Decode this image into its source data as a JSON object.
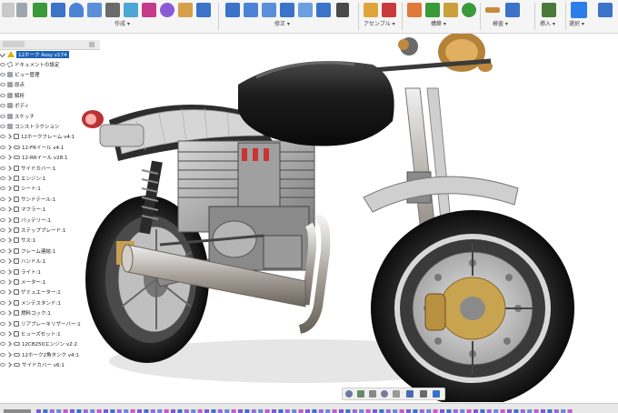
{
  "toolbar": {
    "groups": [
      {
        "name": "create",
        "label": "作成 ▾"
      },
      {
        "name": "modify",
        "label": "修正 ▾"
      },
      {
        "name": "assemble",
        "label": "アセンブル ▾"
      },
      {
        "name": "construct",
        "label": "構築 ▾"
      },
      {
        "name": "inspect",
        "label": "検査 ▾"
      },
      {
        "name": "insert",
        "label": "挿入 ▾"
      },
      {
        "name": "select",
        "label": "選択 ▾"
      }
    ]
  },
  "browser": {
    "doc_title": "12ホーク Assy v174",
    "items": [
      {
        "label": "ドキュメントの設定",
        "icon": "gear-icon",
        "indent": 1
      },
      {
        "label": "ビュー管理",
        "icon": "folder-icon",
        "indent": 1
      },
      {
        "label": "原点",
        "icon": "folder-icon",
        "indent": 1
      },
      {
        "label": "解析",
        "icon": "folder-icon",
        "indent": 1
      },
      {
        "label": "ボディ",
        "icon": "folder-icon",
        "indent": 1
      },
      {
        "label": "スケッチ",
        "icon": "folder-icon",
        "indent": 1
      },
      {
        "label": "コンストラクション",
        "icon": "folder-icon",
        "indent": 1
      },
      {
        "label": "12ホークフレーム v4:1",
        "icon": "component-icon",
        "indent": 2
      },
      {
        "label": "12-FRイール v4:1",
        "icon": "link-icon",
        "indent": 2
      },
      {
        "label": "12-RRイール v28:1",
        "icon": "link-icon",
        "indent": 2
      },
      {
        "label": "サイドカバー:1",
        "icon": "component-icon",
        "indent": 2
      },
      {
        "label": "エンジン:1",
        "icon": "component-icon",
        "indent": 2
      },
      {
        "label": "シート:1",
        "icon": "component-icon",
        "indent": 2
      },
      {
        "label": "サンドテール:1",
        "icon": "component-icon",
        "indent": 2
      },
      {
        "label": "マフラー:1",
        "icon": "component-icon",
        "indent": 2
      },
      {
        "label": "バッテリー:1",
        "icon": "component-icon",
        "indent": 2
      },
      {
        "label": "ステップブレード:1",
        "icon": "component-icon",
        "indent": 2
      },
      {
        "label": "サス:1",
        "icon": "component-icon",
        "indent": 2
      },
      {
        "label": "フレーム連結:1",
        "icon": "component-icon",
        "indent": 2
      },
      {
        "label": "ハンドル:1",
        "icon": "component-icon",
        "indent": 2
      },
      {
        "label": "ライト:1",
        "icon": "component-icon",
        "indent": 2
      },
      {
        "label": "メーター:1",
        "icon": "component-icon",
        "indent": 2
      },
      {
        "label": "ゲミュエーター:1",
        "icon": "component-icon",
        "indent": 2
      },
      {
        "label": "メンテスタンド:1",
        "icon": "component-icon",
        "indent": 2
      },
      {
        "label": "燃料コック:1",
        "icon": "component-icon",
        "indent": 2
      },
      {
        "label": "リアブレーキリザーバー:1",
        "icon": "component-icon",
        "indent": 2
      },
      {
        "label": "ヒューズセット:1",
        "icon": "component-icon",
        "indent": 2
      },
      {
        "label": "12CB250エンジン v2:2",
        "icon": "link-icon",
        "indent": 2
      },
      {
        "label": "12ホーク2角タンク v4:1",
        "icon": "link-icon",
        "indent": 2
      },
      {
        "label": "サイドカバー v6:1",
        "icon": "link-icon",
        "indent": 2
      }
    ]
  },
  "colors": {
    "toolbar_bg": "#f5f5f5",
    "accent_blue": "#2b7de9",
    "timeline_purple": "#7b5bd6",
    "frame_silver": "#b8b8b8",
    "tank_black": "#1a1a1a"
  }
}
